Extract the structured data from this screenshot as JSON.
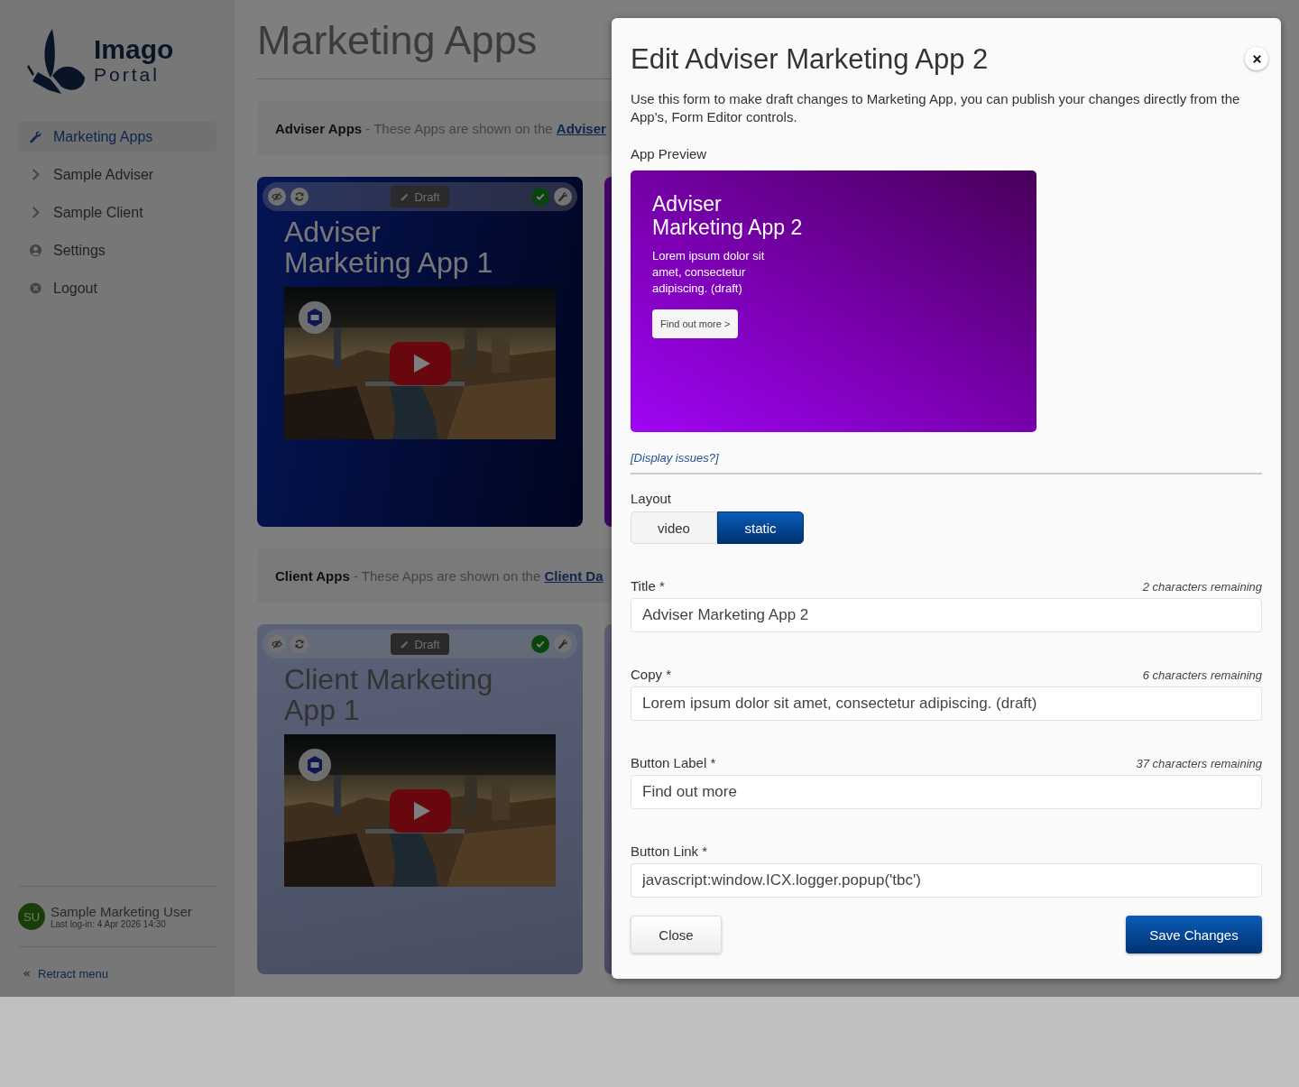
{
  "sidebar": {
    "logo": {
      "name": "Imago",
      "sub": "Portal"
    },
    "items": [
      {
        "label": "Marketing Apps",
        "kind": "tool",
        "selected": true
      },
      {
        "label": "Sample Adviser",
        "kind": "group",
        "selected": false
      },
      {
        "label": "Sample Client",
        "kind": "group",
        "selected": false
      },
      {
        "label": "Settings",
        "kind": "account",
        "selected": false
      },
      {
        "label": "Logout",
        "kind": "exit",
        "selected": false
      }
    ],
    "user": {
      "initials": "SU",
      "name": "Sample Marketing User",
      "last_login": "Last log-in: 4 Apr 2026 14:30"
    },
    "retract": "Retract menu"
  },
  "page": {
    "title": "Marketing Apps",
    "sections": [
      {
        "heading": "Adviser Apps",
        "text": " - These Apps are shown on the ",
        "link": "Adviser",
        "apps": [
          {
            "title": "Adviser Marketing App 1",
            "status": "Draft",
            "approved": true,
            "kind": "blue"
          },
          {
            "kind": "purple"
          }
        ]
      },
      {
        "heading": "Client Apps",
        "text": " - These Apps are shown on the ",
        "link": "Client Da",
        "apps": [
          {
            "title": "Client Marketing App 1",
            "status": "Draft",
            "approved": true,
            "kind": "periwinkle"
          },
          {
            "kind": "lilac"
          }
        ]
      }
    ]
  },
  "modal": {
    "title": "Edit Adviser Marketing App 2",
    "description": "Use this form to make draft changes to Marketing App, you can publish your changes directly from the App's, Form Editor controls.",
    "preview_label": "App Preview",
    "preview": {
      "title": "Adviser Marketing App 2",
      "copy": "Lorem ipsum dolor sit amet, consectetur adipiscing. (draft)",
      "button": "Find out more >"
    },
    "display_issues": "[Display issues?]",
    "layout": {
      "label": "Layout",
      "options": [
        {
          "label": "video",
          "selected": false
        },
        {
          "label": "static",
          "selected": true
        }
      ]
    },
    "fields": [
      {
        "label": "Title",
        "marker": "*",
        "remaining": "2 characters remaining",
        "value": "Adviser Marketing App 2"
      },
      {
        "label": "Copy",
        "marker": "*",
        "remaining": "6 characters remaining",
        "value": "Lorem ipsum dolor sit amet, consectetur adipiscing. (draft)"
      },
      {
        "label": "Button Label",
        "marker": "*",
        "remaining": "37 characters remaining",
        "value": "Find out more"
      },
      {
        "label": "Button Link",
        "marker": "*",
        "value": "javascript:window.ICX.logger.popup('tbc')"
      }
    ],
    "close": "Close",
    "save": "Save Changes"
  }
}
